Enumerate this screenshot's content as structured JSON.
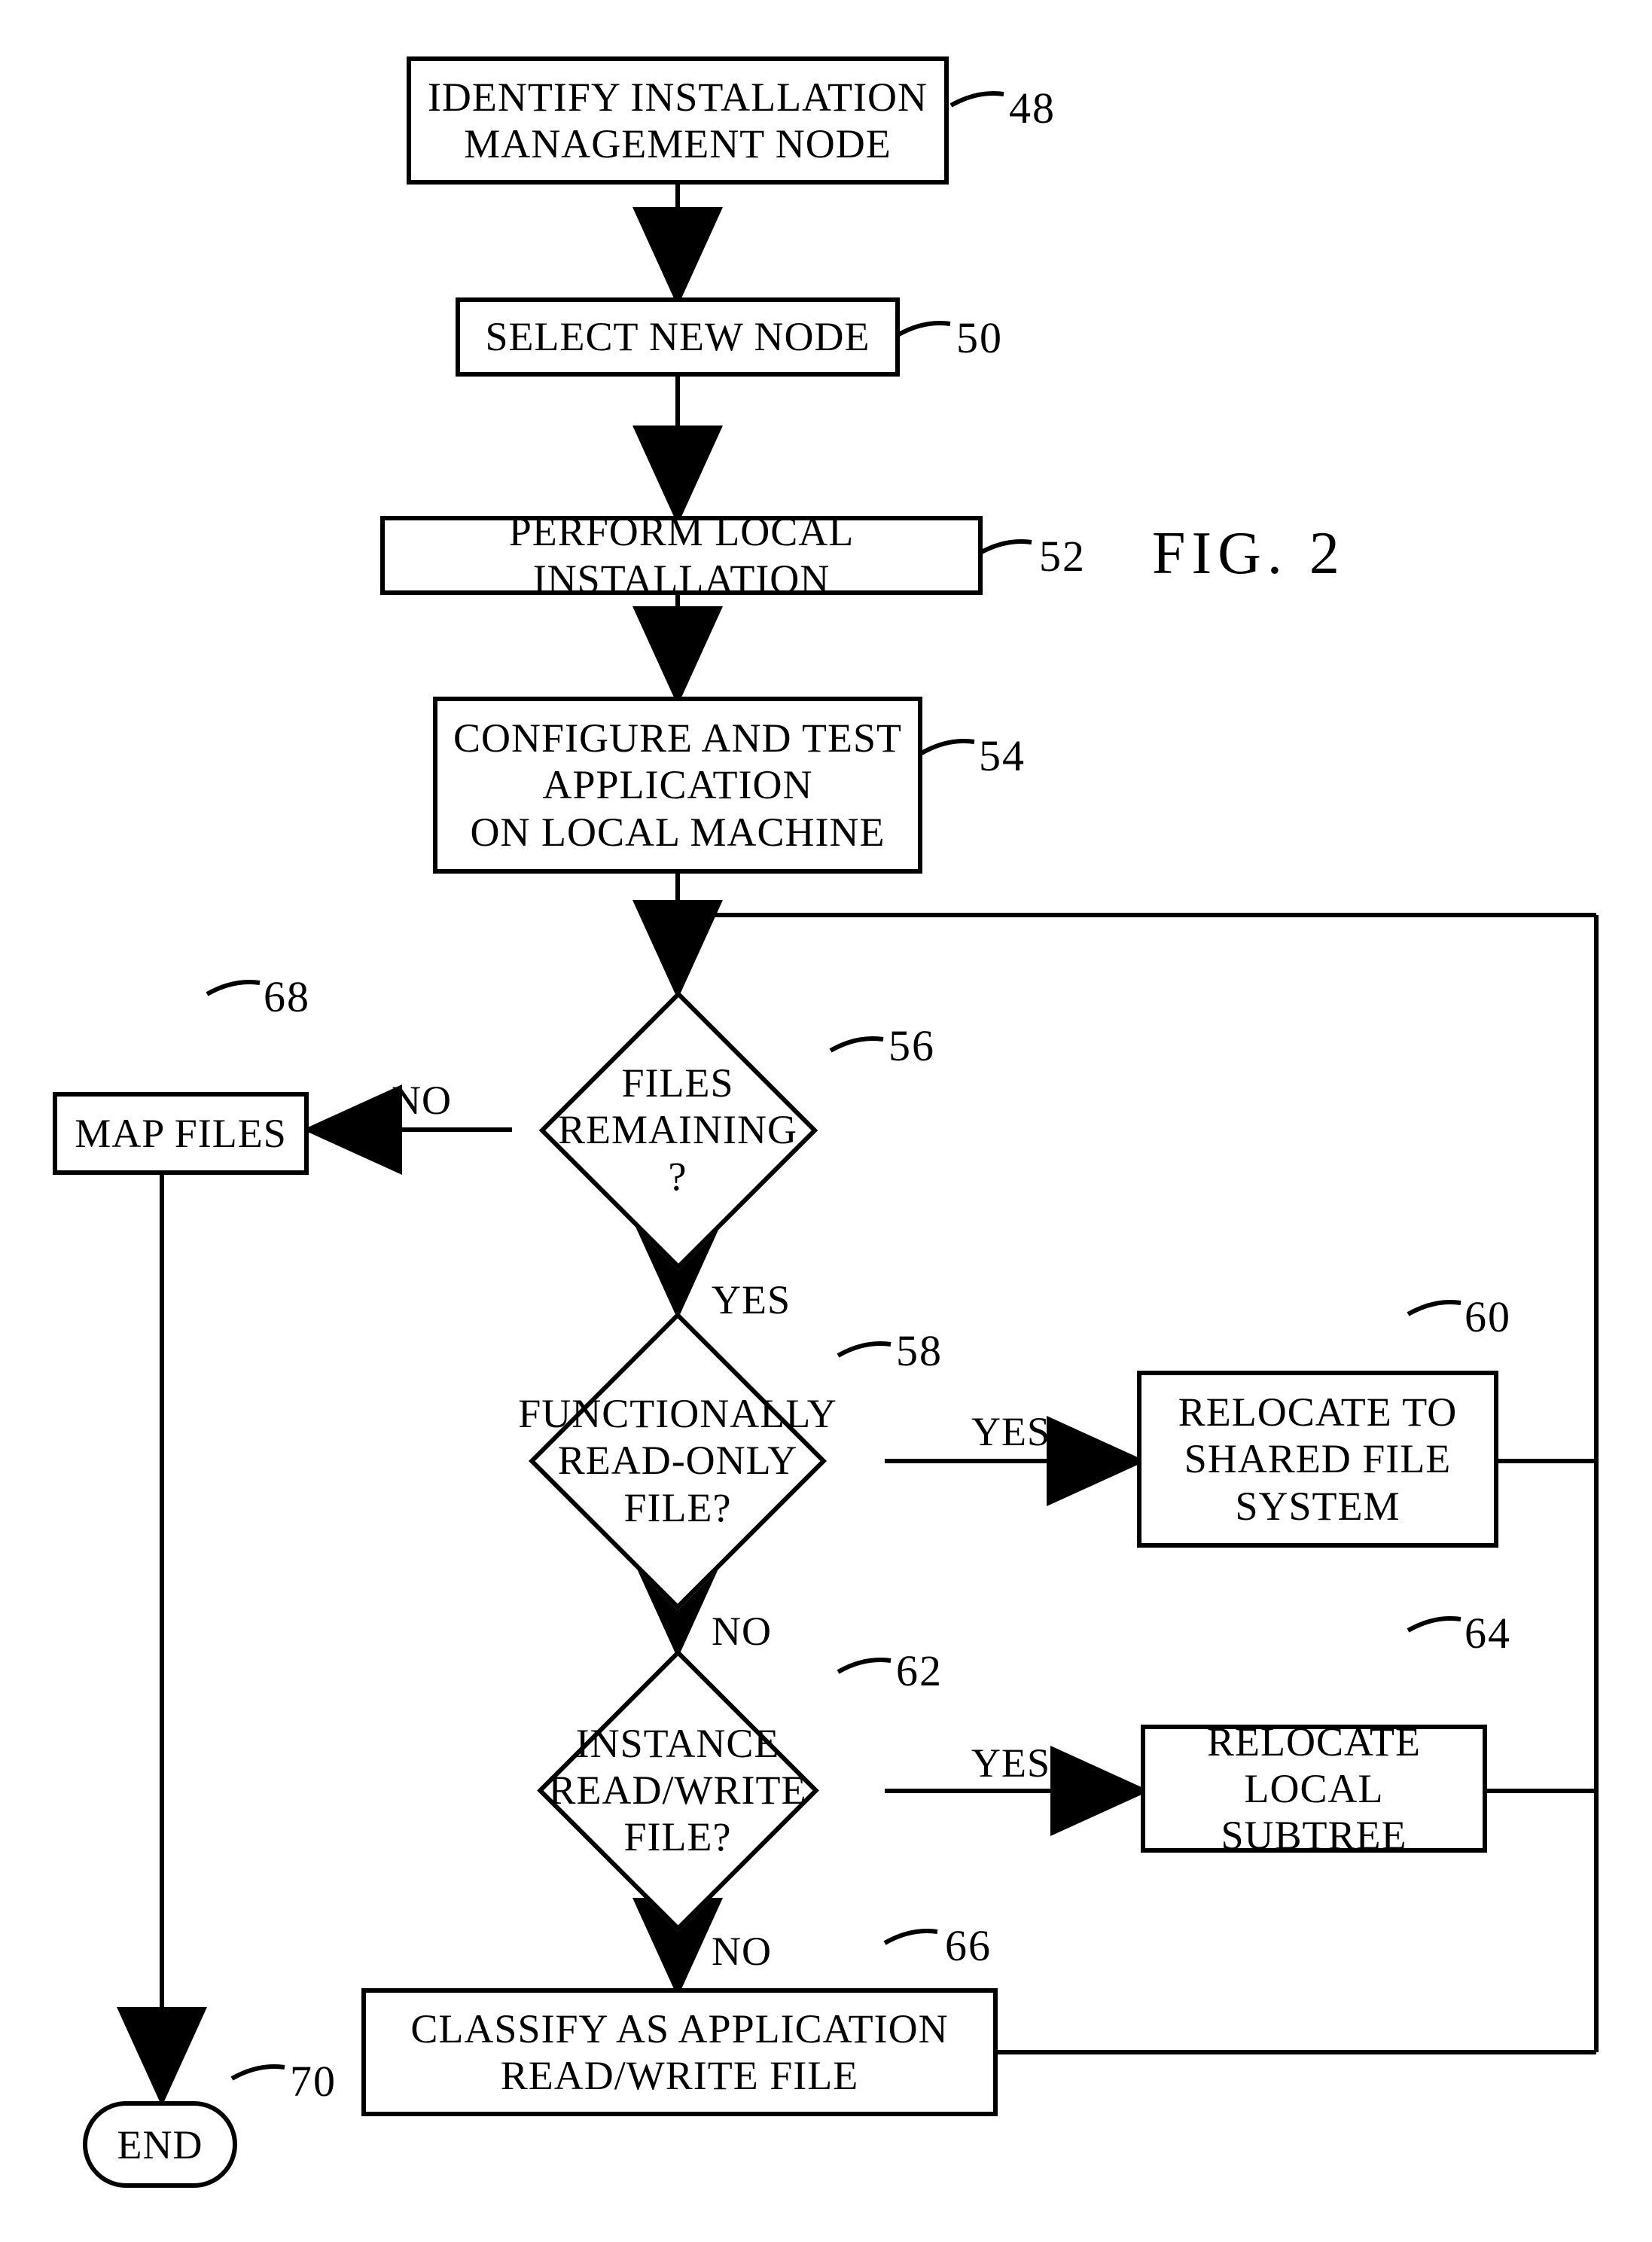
{
  "figure_label": "FIG.  2",
  "nodes": {
    "n48": {
      "text": "IDENTIFY INSTALLATION\nMANAGEMENT NODE",
      "num": "48"
    },
    "n50": {
      "text": "SELECT NEW NODE",
      "num": "50"
    },
    "n52": {
      "text": "PERFORM LOCAL INSTALLATION",
      "num": "52"
    },
    "n54": {
      "text": "CONFIGURE AND TEST\nAPPLICATION\nON LOCAL MACHINE",
      "num": "54"
    },
    "n56": {
      "text": "FILES\nREMAINING\n?",
      "num": "56"
    },
    "n58": {
      "text": "FUNCTIONALLY\nREAD-ONLY\nFILE?",
      "num": "58"
    },
    "n60": {
      "text": "RELOCATE TO\nSHARED FILE\nSYSTEM",
      "num": "60"
    },
    "n62": {
      "text": "INSTANCE\nREAD/WRITE\nFILE?",
      "num": "62"
    },
    "n64": {
      "text": "RELOCATE\nLOCAL SUBTREE",
      "num": "64"
    },
    "n66": {
      "text": "CLASSIFY AS APPLICATION\nREAD/WRITE FILE",
      "num": "66"
    },
    "n68": {
      "text": "MAP FILES",
      "num": "68"
    },
    "n70": {
      "text": "END",
      "num": "70"
    }
  },
  "edge_labels": {
    "yes": "YES",
    "no": "NO"
  }
}
